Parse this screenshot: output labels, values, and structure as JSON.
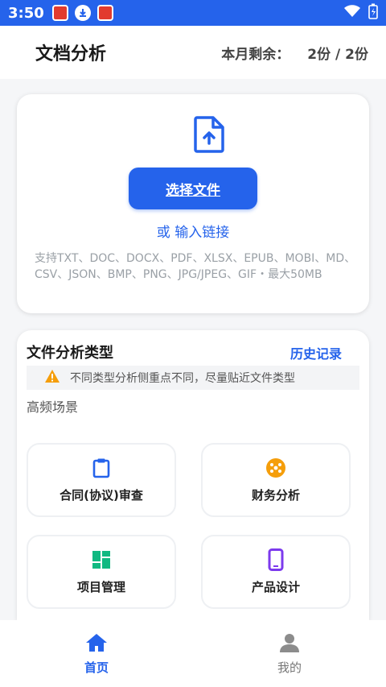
{
  "status_bar": {
    "time": "3:50"
  },
  "header": {
    "title": "文档分析",
    "quota_label": "本月剩余：",
    "quota_value": "2份 / 2份"
  },
  "upload": {
    "choose_button": "选择文件",
    "or_text": "或",
    "link_text": "输入链接",
    "support_text": "支持TXT、DOC、DOCX、PDF、XLSX、EPUB、MOBI、MD、CSV、JSON、BMP、PNG、JPG/JPEG、GIF・最大50MB"
  },
  "analysis": {
    "title": "文件分析类型",
    "history": "历史记录",
    "warning": "不同类型分析侧重点不同，尽量贴近文件类型",
    "scene_label": "高频场景",
    "scenes": [
      {
        "name": "合同(协议)审查",
        "icon": "clipboard-icon",
        "color": "#2563eb"
      },
      {
        "name": "财务分析",
        "icon": "finance-icon",
        "color": "#f59e0b"
      },
      {
        "name": "项目管理",
        "icon": "dashboard-icon",
        "color": "#10b981"
      },
      {
        "name": "产品设计",
        "icon": "phone-icon",
        "color": "#7c3aed"
      }
    ]
  },
  "nav": {
    "home": "首页",
    "mine": "我的"
  },
  "colors": {
    "accent": "#2563eb",
    "warning": "#f59e0b"
  }
}
